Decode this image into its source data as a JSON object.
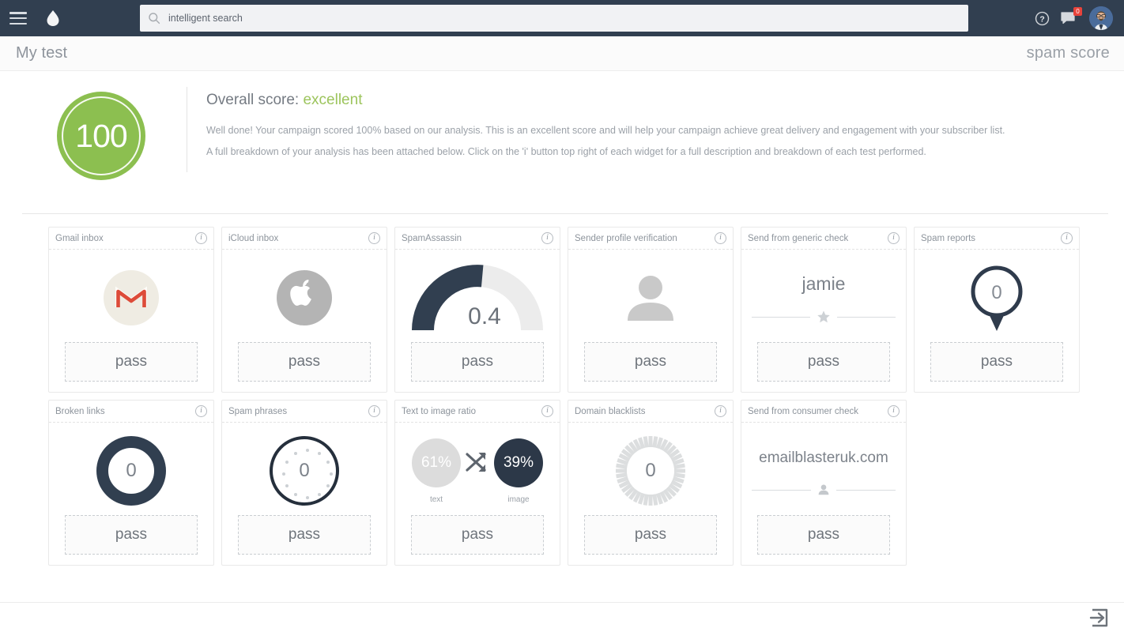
{
  "topnav": {
    "menu_icon": "hamburger-icon",
    "logo_icon": "cloud-logo-icon",
    "search": {
      "value": "intelligent search",
      "placeholder": "intelligent search",
      "icon": "search-icon"
    },
    "help_icon": "help-icon",
    "messages_icon": "message-icon",
    "messages_badge": "0",
    "avatar": "user-avatar"
  },
  "titlebar": {
    "title": "My test",
    "section": "spam score"
  },
  "summary": {
    "score": "100",
    "score_color": "#8cbf50",
    "overall_label": "Overall score:",
    "rating": "excellent",
    "paragraph1": "Well done! Your campaign scored 100% based on our analysis. This is an excellent score and will help your campaign achieve great delivery and engagement with your subscriber list.",
    "paragraph2": "A full breakdown of your analysis has been attached below. Click on the 'i' button top right of each widget for a full description and breakdown of each test performed."
  },
  "cards": [
    {
      "title": "Gmail inbox",
      "viz": "gmail-logo",
      "status": "pass"
    },
    {
      "title": "iCloud inbox",
      "viz": "apple-logo",
      "status": "pass"
    },
    {
      "title": "SpamAssassin",
      "viz": "gauge",
      "value": "0.4",
      "gauge_pct": 48,
      "status": "pass"
    },
    {
      "title": "Sender profile verification",
      "viz": "person",
      "status": "pass"
    },
    {
      "title": "Send from generic check",
      "viz": "value-star",
      "value": "jamie",
      "status": "pass"
    },
    {
      "title": "Spam reports",
      "viz": "pin",
      "value": "0",
      "status": "pass"
    },
    {
      "title": "Broken links",
      "viz": "ring-thick",
      "value": "0",
      "status": "pass"
    },
    {
      "title": "Spam phrases",
      "viz": "ring-clock",
      "value": "0",
      "status": "pass"
    },
    {
      "title": "Text to image ratio",
      "viz": "ratio",
      "text_pct": "61%",
      "image_pct": "39%",
      "text_label": "text",
      "image_label": "image",
      "status": "pass"
    },
    {
      "title": "Domain blacklists",
      "viz": "seg-ring",
      "value": "0",
      "status": "pass"
    },
    {
      "title": "Send from consumer check",
      "viz": "value-person",
      "value": "emailblasteruk.com",
      "status": "pass"
    }
  ],
  "footer": {
    "logout_icon": "logout-icon"
  },
  "colors": {
    "navy": "#313f50",
    "green": "#8cbf50",
    "muted": "#9ba1a8",
    "badge_red": "#e8433b"
  }
}
